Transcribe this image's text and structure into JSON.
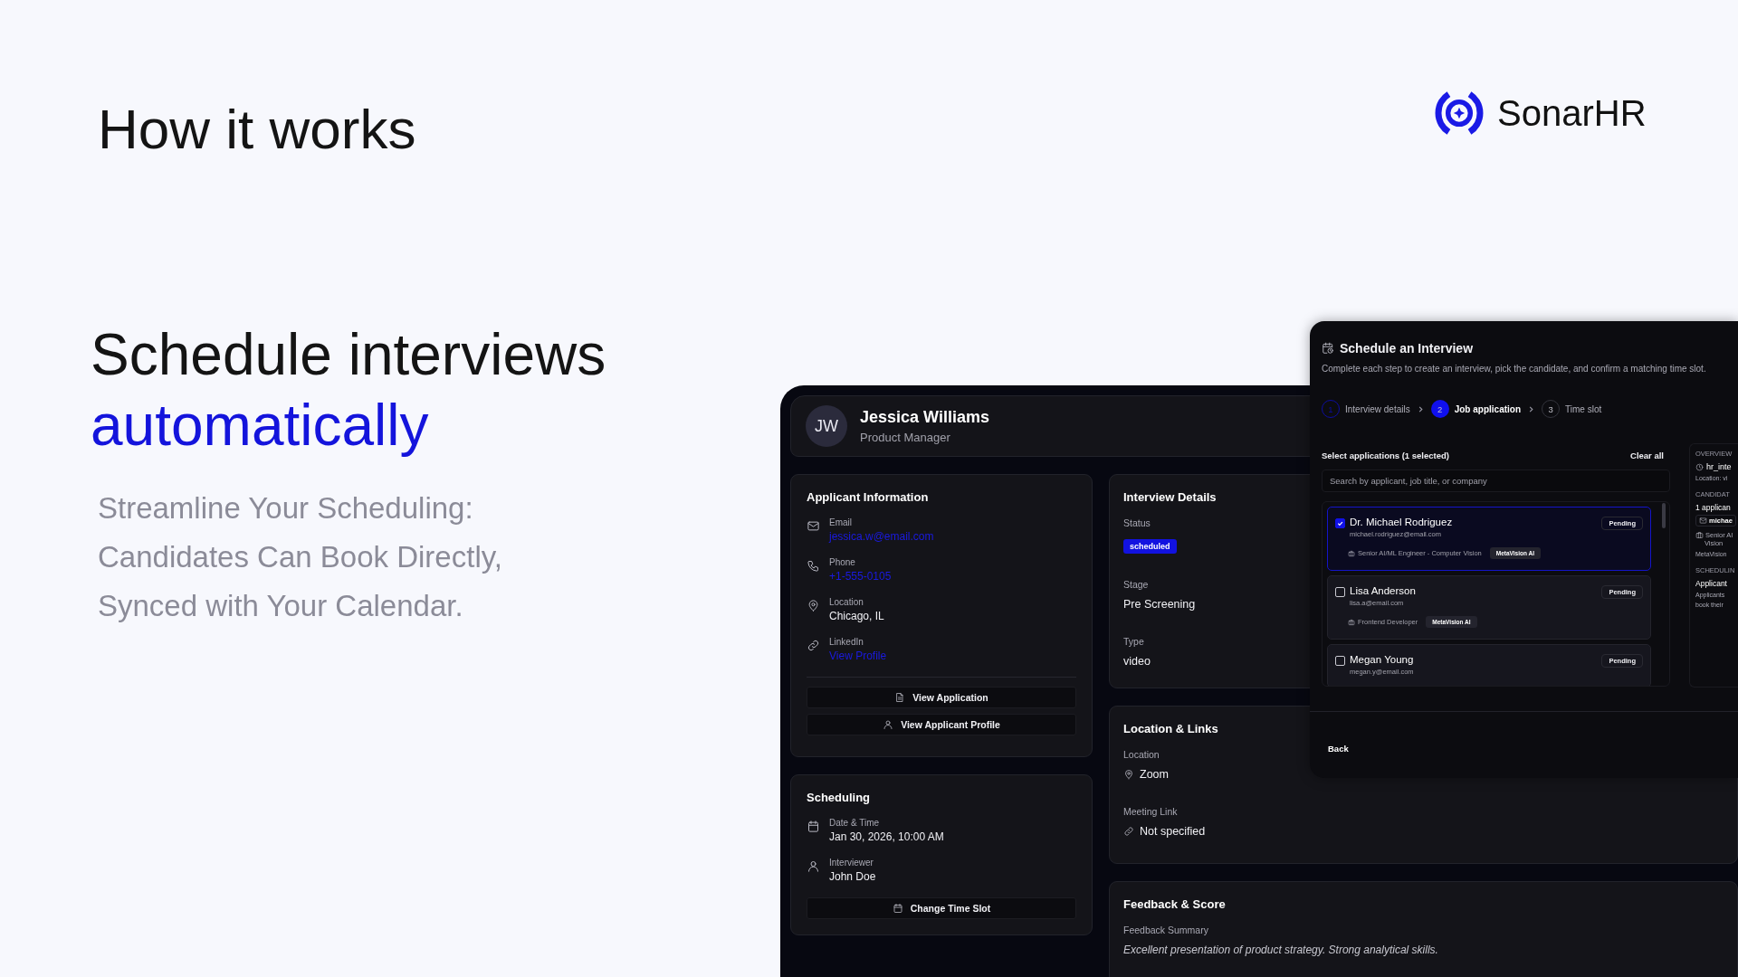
{
  "page": {
    "heading": "How it works",
    "headline": "Schedule interviews",
    "headline_accent": "automatically",
    "subtitle_lines": [
      "Streamline Your Scheduling:",
      "Candidates Can Book Directly,",
      "Synced with Your Calendar."
    ]
  },
  "brand": {
    "name": "SonarHR"
  },
  "interview_page": {
    "applicant": {
      "initials": "JW",
      "name": "Jessica Williams",
      "role": "Product Manager"
    },
    "applicant_info": {
      "title": "Applicant Information",
      "fields": [
        {
          "kind": "mail",
          "label": "Email",
          "value": "jessica.w@email.com",
          "link": true
        },
        {
          "kind": "phone",
          "label": "Phone",
          "value": "+1-555-0105",
          "link": true
        },
        {
          "kind": "pin",
          "label": "Location",
          "value": "Chicago, IL",
          "link": false
        },
        {
          "kind": "link",
          "label": "LinkedIn",
          "value": "View Profile",
          "link": true
        }
      ],
      "buttons": [
        {
          "kind": "doc",
          "label": "View Application"
        },
        {
          "kind": "user",
          "label": "View Applicant Profile"
        }
      ]
    },
    "scheduling": {
      "title": "Scheduling",
      "fields": [
        {
          "kind": "calendar",
          "label": "Date & Time",
          "value": "Jan 30, 2026, 10:00 AM",
          "link": false
        },
        {
          "kind": "user",
          "label": "Interviewer",
          "value": "John Doe",
          "link": false
        }
      ],
      "buttons": [
        {
          "kind": "calendar",
          "label": "Change Time Slot"
        }
      ]
    },
    "interview_details": {
      "title": "Interview Details",
      "status_label": "Status",
      "status": "scheduled",
      "stage_label": "Stage",
      "stage": "Pre Screening",
      "type_label": "Type",
      "type": "video"
    },
    "location_links": {
      "title": "Location & Links",
      "items": [
        {
          "kind": "pin",
          "label": "Location",
          "value": "Zoom"
        },
        {
          "kind": "link",
          "label": "Meeting Link",
          "value": "Not specified"
        }
      ]
    },
    "feedback": {
      "title": "Feedback & Score",
      "label": "Feedback Summary",
      "summary": "Excellent presentation of product strategy. Strong analytical skills."
    }
  },
  "schedule_modal": {
    "title": "Schedule an Interview",
    "description": "Complete each step to create an interview, pick the candidate, and confirm a matching time slot.",
    "steps": [
      {
        "number": "1",
        "label": "Interview details",
        "completed": true,
        "selected": false
      },
      {
        "number": "2",
        "label": "Job application",
        "completed": false,
        "selected": true
      },
      {
        "number": "3",
        "label": "Time slot",
        "completed": false,
        "selected": false
      }
    ],
    "list_title": "Select applications (1 selected)",
    "clear_label": "Clear all",
    "search": {
      "placeholder": "Search by applicant, job title, or company"
    },
    "applications": [
      {
        "name": "Dr. Michael Rodriguez",
        "email": "michael.rodriguez@email.com",
        "job": "Senior AI/ML Engineer - Computer Vision",
        "company": "MetaVision AI",
        "status": "Pending",
        "selected": true
      },
      {
        "name": "Lisa Anderson",
        "email": "lisa.a@email.com",
        "job": "Frontend Developer",
        "company": "MetaVision AI",
        "status": "Pending",
        "selected": false
      },
      {
        "name": "Megan Young",
        "email": "megan.y@email.com",
        "status": "Pending",
        "selected": false
      }
    ],
    "overview": [
      {
        "kind": "heading",
        "text": "OVERVIEW"
      },
      {
        "kind": "clock",
        "text": "hr_inte"
      },
      {
        "kind": "muted",
        "text": "Location: vi"
      },
      {
        "kind": "heading",
        "text": "CANDIDAT"
      },
      {
        "kind": "strong",
        "text": "1 applican"
      },
      {
        "kind": "chip",
        "text": "michae"
      },
      {
        "kind": "job",
        "text": "Senior AI"
      },
      {
        "kind": "indent",
        "text": "Vision"
      },
      {
        "kind": "muted",
        "text": "MetaVision"
      },
      {
        "kind": "heading",
        "text": "SCHEDULIN"
      },
      {
        "kind": "strong",
        "text": "Applicant"
      },
      {
        "kind": "muted",
        "text": "Applicants"
      },
      {
        "kind": "muted",
        "text": "book their"
      }
    ],
    "back_label": "Back"
  }
}
